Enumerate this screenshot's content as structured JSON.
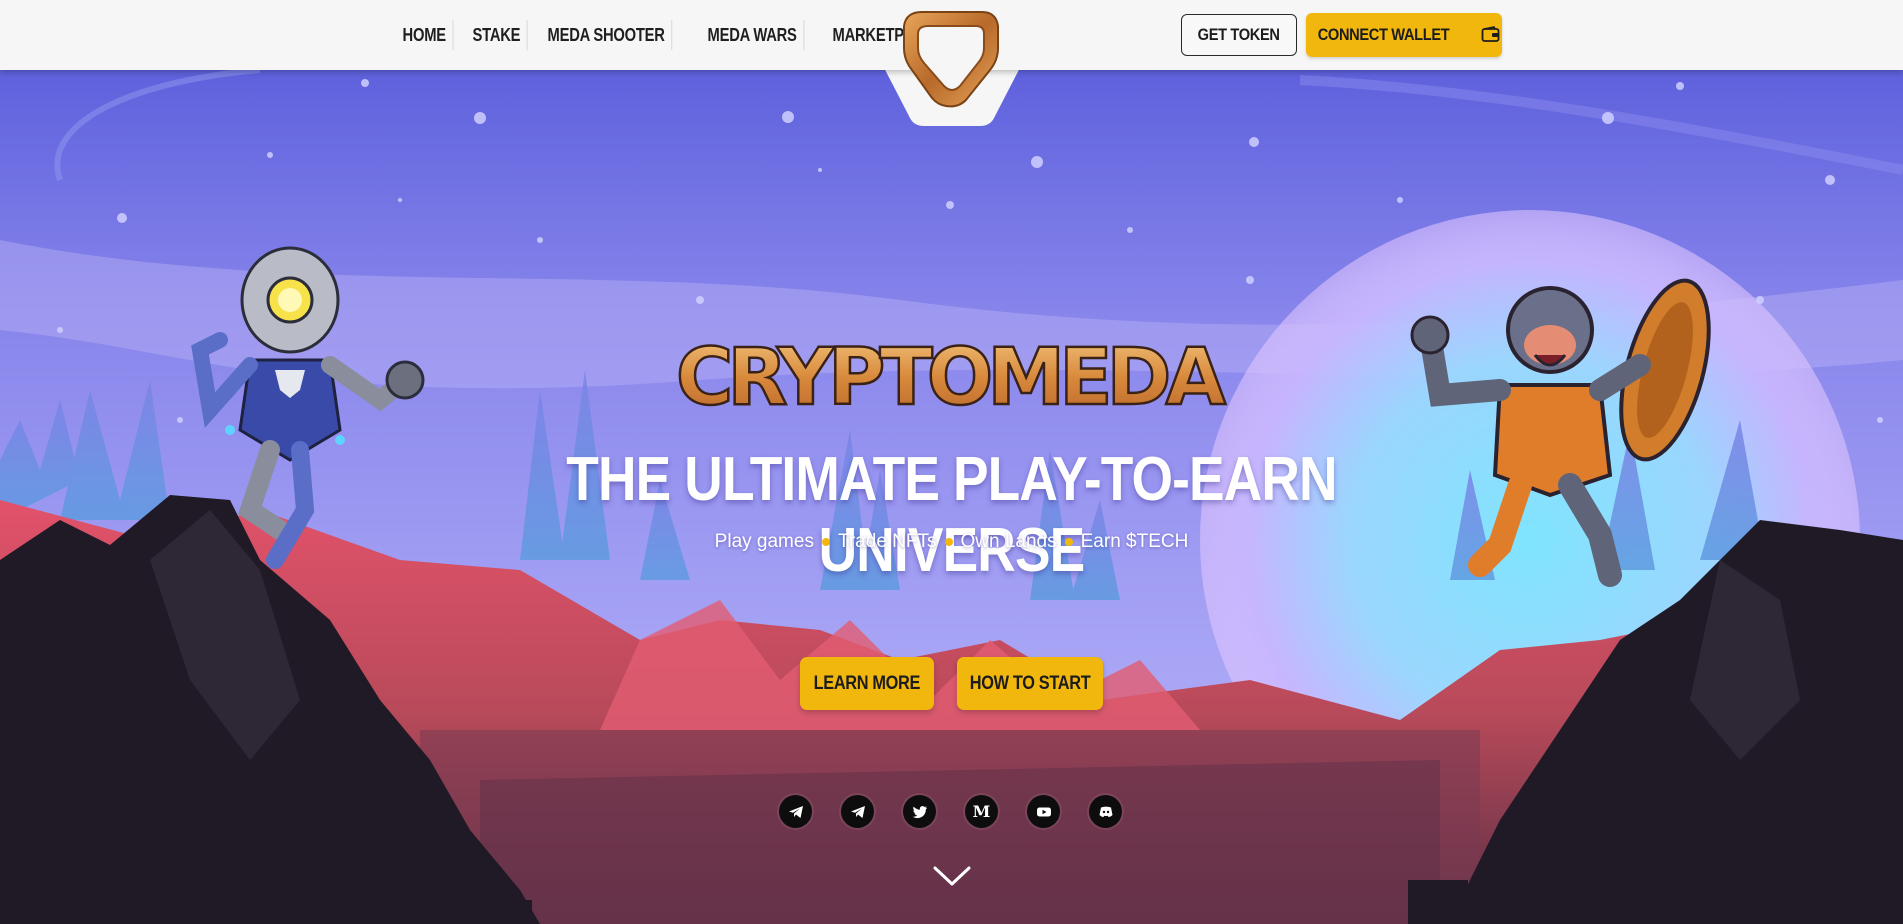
{
  "nav": {
    "items": [
      {
        "label": "HOME"
      },
      {
        "label": "STAKE"
      },
      {
        "label": "MEDA SHOOTER"
      },
      {
        "label": "MEDA WARS"
      },
      {
        "label": "MARKETPLACE"
      }
    ]
  },
  "header": {
    "get_token_label": "GET TOKEN",
    "connect_wallet_label": "CONNECT WALLET",
    "wallet_icon": "wallet-icon"
  },
  "hero": {
    "brand": "CRYPTOMEDA",
    "headline": "THE ULTIMATE PLAY-TO-EARN UNIVERSE",
    "tagline": [
      "Play games",
      "Trade NFTs",
      "Own Lands",
      "Earn $TECH"
    ],
    "learn_more_label": "LEARN MORE",
    "how_to_start_label": "HOW TO START"
  },
  "socials": [
    {
      "icon": "telegram-icon"
    },
    {
      "icon": "telegram-icon"
    },
    {
      "icon": "twitter-icon"
    },
    {
      "icon": "medium-icon",
      "glyph": "M"
    },
    {
      "icon": "youtube-icon"
    },
    {
      "icon": "discord-icon"
    }
  ],
  "colors": {
    "accent": "#f2b70d",
    "header_bg": "#f6f6f6",
    "sky_top": "#5b5fde",
    "sky_mid": "#8d8af0",
    "rock_dark": "#1f1a26",
    "ground_red": "#d8425c",
    "text_dark": "#1c1c1c"
  }
}
